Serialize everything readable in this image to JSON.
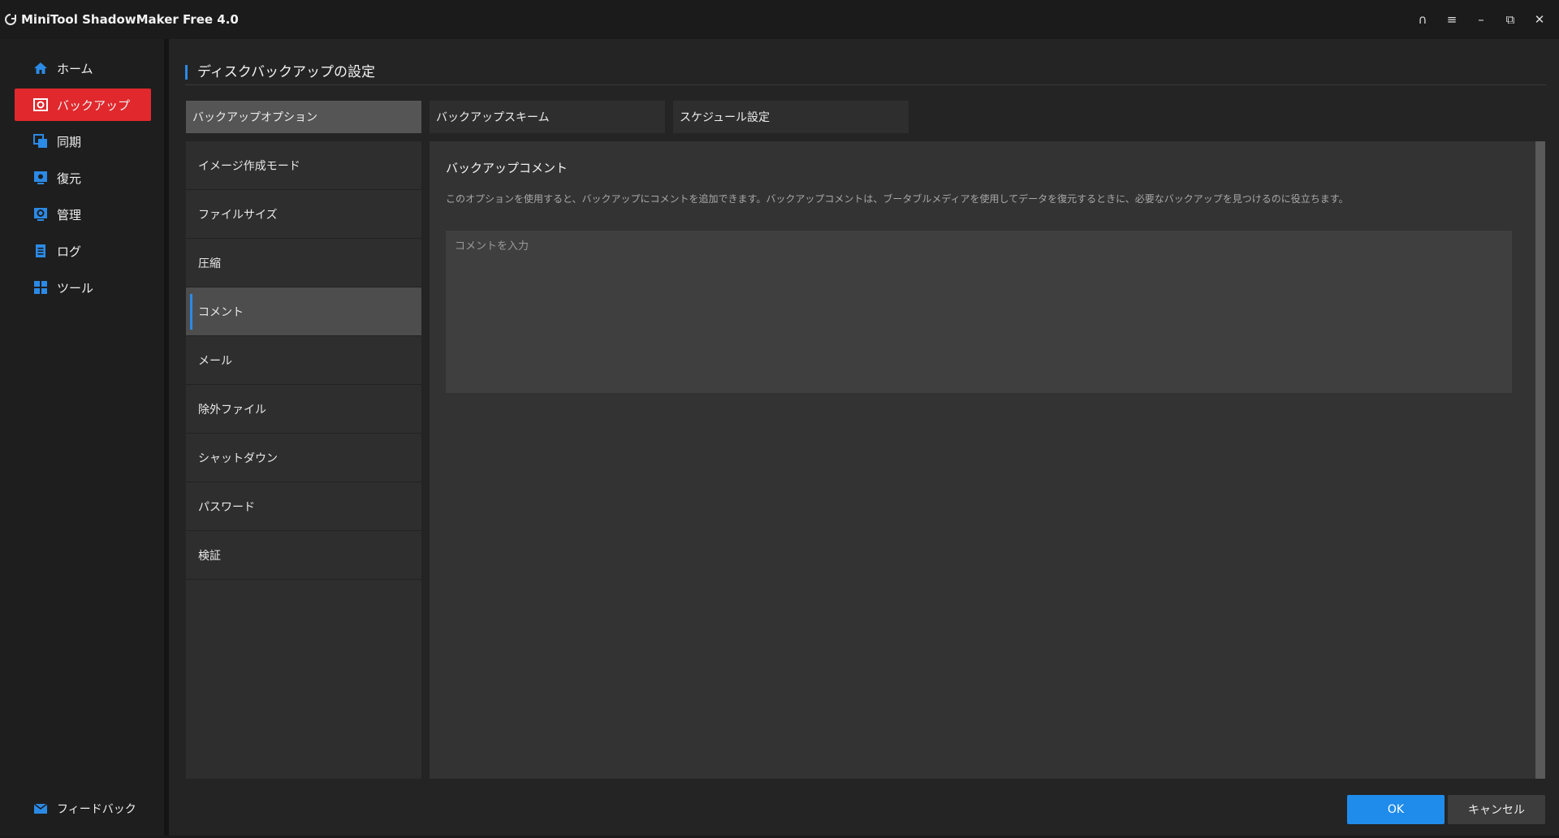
{
  "app": {
    "title": "MiniTool ShadowMaker Free 4.0"
  },
  "window_controls": [
    {
      "name": "headset-icon",
      "glyph": "∩"
    },
    {
      "name": "menu-icon",
      "glyph": "≡"
    },
    {
      "name": "minimize-icon",
      "glyph": "–"
    },
    {
      "name": "restore-icon",
      "glyph": "⧉"
    },
    {
      "name": "close-icon",
      "glyph": "✕"
    }
  ],
  "sidebar": {
    "items": [
      {
        "label": "ホーム",
        "icon": "home-icon"
      },
      {
        "label": "バックアップ",
        "icon": "backup-icon",
        "active": true
      },
      {
        "label": "同期",
        "icon": "sync-icon"
      },
      {
        "label": "復元",
        "icon": "restore-data-icon"
      },
      {
        "label": "管理",
        "icon": "manage-icon"
      },
      {
        "label": "ログ",
        "icon": "log-icon"
      },
      {
        "label": "ツール",
        "icon": "tools-icon"
      }
    ],
    "feedback": {
      "label": "フィードバック",
      "icon": "mail-icon"
    }
  },
  "page": {
    "title": "ディスクバックアップの設定"
  },
  "tabs": [
    {
      "label": "バックアップオプション",
      "active": true
    },
    {
      "label": "バックアップスキーム"
    },
    {
      "label": "スケジュール設定"
    }
  ],
  "options": [
    {
      "label": "イメージ作成モード"
    },
    {
      "label": "ファイルサイズ"
    },
    {
      "label": "圧縮"
    },
    {
      "label": "コメント",
      "selected": true
    },
    {
      "label": "メール"
    },
    {
      "label": "除外ファイル"
    },
    {
      "label": "シャットダウン"
    },
    {
      "label": "パスワード"
    },
    {
      "label": "検証"
    }
  ],
  "detail": {
    "title": "バックアップコメント",
    "description": "このオプションを使用すると、バックアップにコメントを追加できます。バックアップコメントは、ブータブルメディアを使用してデータを復元するときに、必要なバックアップを見つけるのに役立ちます。",
    "comment_placeholder": "コメントを入力",
    "comment_value": ""
  },
  "buttons": {
    "ok": "OK",
    "cancel": "キャンセル"
  },
  "colors": {
    "accent": "#2b8ae6",
    "active_nav": "#e0282d",
    "ok_button": "#1f8ceb"
  }
}
